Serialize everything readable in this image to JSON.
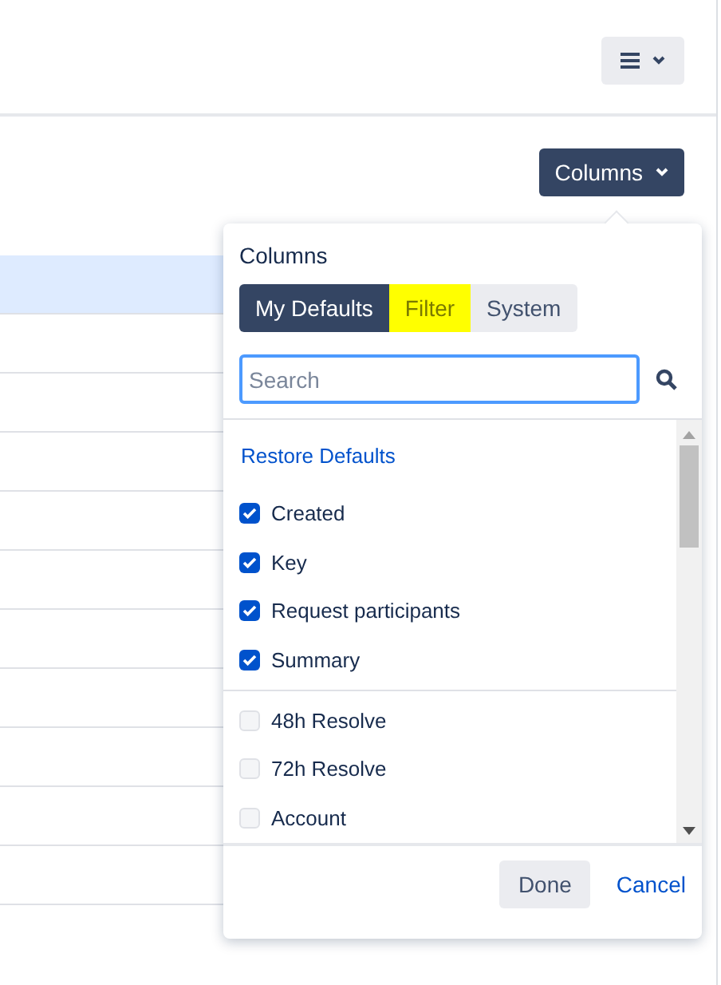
{
  "toolbar": {
    "columns_button": {
      "label": "Columns",
      "expanded": true
    }
  },
  "table": {
    "rows": [
      {
        "selected": true
      },
      {
        "selected": false
      },
      {
        "selected": false
      },
      {
        "selected": false
      },
      {
        "selected": false
      },
      {
        "selected": false
      },
      {
        "selected": false
      },
      {
        "selected": false
      },
      {
        "selected": false
      },
      {
        "selected": false
      },
      {
        "selected": false
      }
    ]
  },
  "columns_panel": {
    "title": "Columns",
    "tabs": [
      {
        "label": "My Defaults",
        "selected": true,
        "highlighted": false
      },
      {
        "label": "Filter",
        "selected": false,
        "highlighted": true
      },
      {
        "label": "System",
        "selected": false,
        "highlighted": false
      }
    ],
    "search": {
      "placeholder": "Search"
    },
    "restore_link": "Restore Defaults",
    "groups": [
      [
        {
          "label": "Created",
          "checked": true
        },
        {
          "label": "Key",
          "checked": true
        },
        {
          "label": "Request participants",
          "checked": true
        },
        {
          "label": "Summary",
          "checked": true
        }
      ],
      [
        {
          "label": "48h Resolve",
          "checked": false
        },
        {
          "label": "72h Resolve",
          "checked": false
        },
        {
          "label": "Account",
          "checked": false
        }
      ]
    ],
    "buttons": [
      {
        "label": "Done",
        "kind": "primary"
      },
      {
        "label": "Cancel",
        "kind": "link"
      }
    ]
  }
}
